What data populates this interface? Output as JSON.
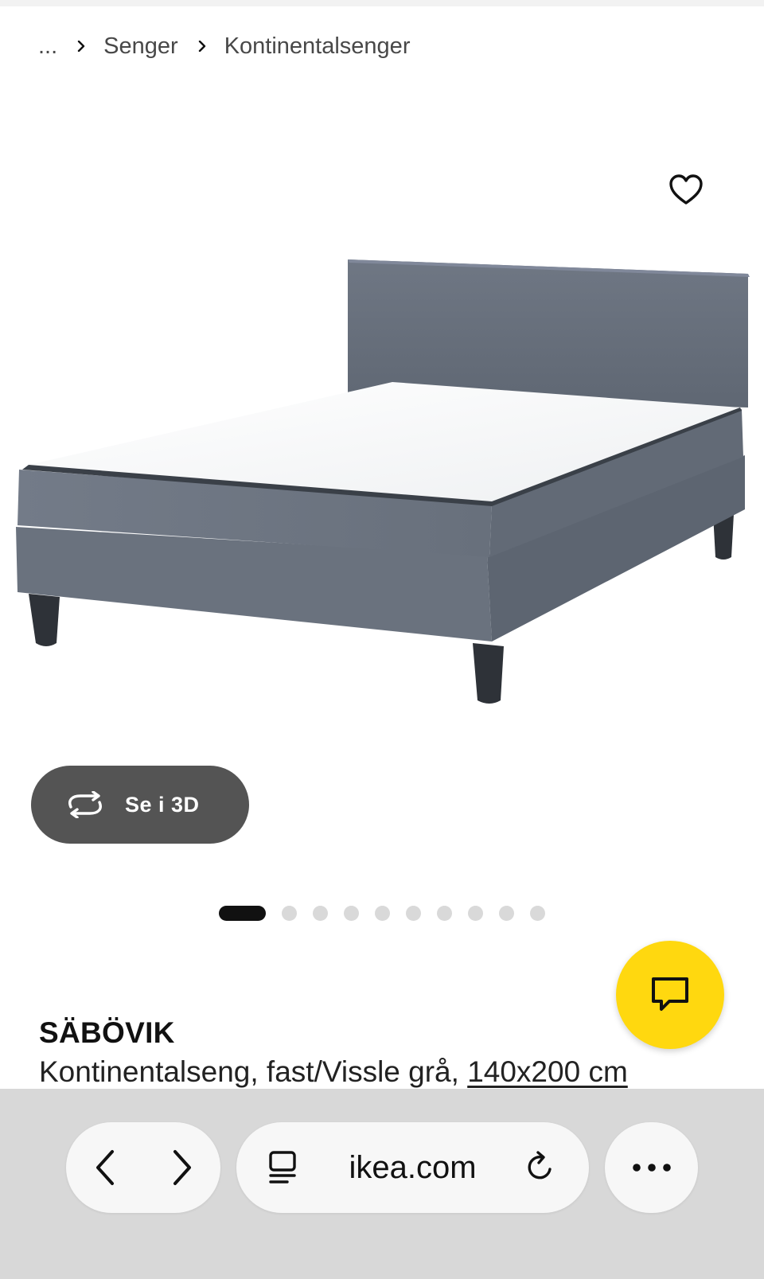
{
  "breadcrumb": {
    "items": [
      "...",
      "Senger",
      "Kontinentalsenger"
    ]
  },
  "product": {
    "name": "SÄBÖVIK",
    "description": "Kontinentalseng, fast/Vissle grå,",
    "size": "140x200 cm",
    "view3d_label": "Se i 3D",
    "gallery": {
      "current": 1,
      "total": 10
    }
  },
  "browser": {
    "url": "ikea.com"
  },
  "colors": {
    "chat_button": "#ffd80f",
    "view3d_button": "#545454",
    "active_dot": "#111111",
    "inactive_dot": "#d9d9d9",
    "bed_fabric": "#6e7683",
    "mattress": "#ffffff"
  },
  "icons": {
    "favorite": "heart-icon",
    "view3d": "rotate-3d-icon",
    "chat": "chat-icon",
    "back": "chevron-left-icon",
    "forward": "chevron-right-icon",
    "reader": "reader-mode-icon",
    "reload": "reload-icon",
    "more": "more-icon"
  }
}
